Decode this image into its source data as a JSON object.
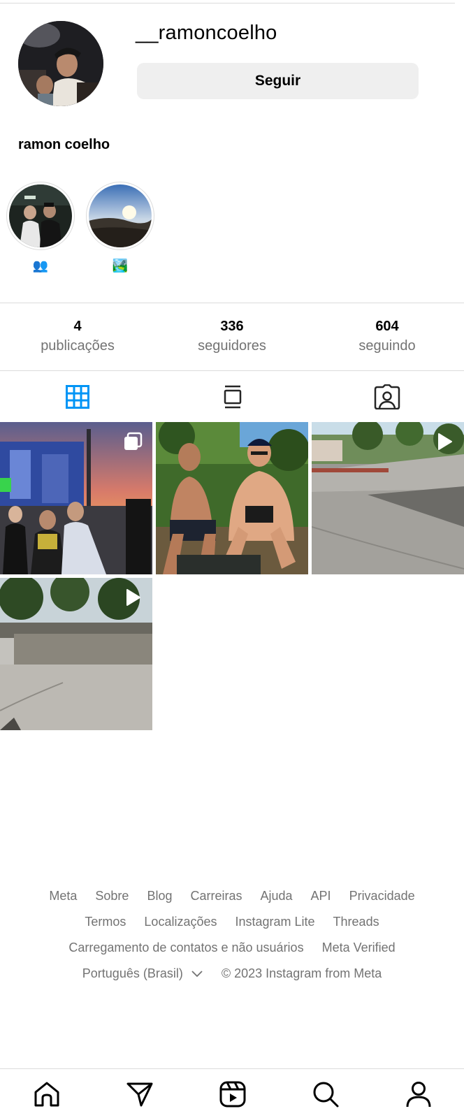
{
  "profile": {
    "username": "__ramoncoelho",
    "full_name": "ramon coelho",
    "follow_label": "Seguir"
  },
  "highlights": [
    {
      "label": "👥",
      "icon": "people-emoji"
    },
    {
      "label": "🏞️",
      "icon": "landscape-emoji"
    }
  ],
  "stats": {
    "posts": {
      "value": "4",
      "label": "publicações"
    },
    "followers": {
      "value": "336",
      "label": "seguidores"
    },
    "following": {
      "value": "604",
      "label": "seguindo"
    }
  },
  "tabs": [
    {
      "icon": "grid-icon",
      "active": true
    },
    {
      "icon": "feed-icon",
      "active": false
    },
    {
      "icon": "tagged-icon",
      "active": false
    }
  ],
  "posts": [
    {
      "type": "carousel",
      "badge_icon": "carousel-icon"
    },
    {
      "type": "photo"
    },
    {
      "type": "reel",
      "badge_icon": "play-icon"
    },
    {
      "type": "reel",
      "badge_icon": "play-icon"
    }
  ],
  "footer": {
    "links": {
      "meta": "Meta",
      "sobre": "Sobre",
      "blog": "Blog",
      "carreiras": "Carreiras",
      "ajuda": "Ajuda",
      "api": "API",
      "privacidade": "Privacidade",
      "termos": "Termos",
      "localizacoes": "Localizações",
      "lite": "Instagram Lite",
      "threads": "Threads",
      "contatos": "Carregamento de contatos e não usuários",
      "verified": "Meta Verified"
    },
    "language": "Português (Brasil)",
    "copyright": "© 2023 Instagram from Meta"
  },
  "colors": {
    "active_tab": "#0095f6",
    "secondary_text": "#737373",
    "divider": "#dbdbdb",
    "button_bg": "#efefef"
  },
  "nav": [
    "home-icon",
    "direct-icon",
    "reels-icon",
    "search-icon",
    "profile-icon"
  ]
}
